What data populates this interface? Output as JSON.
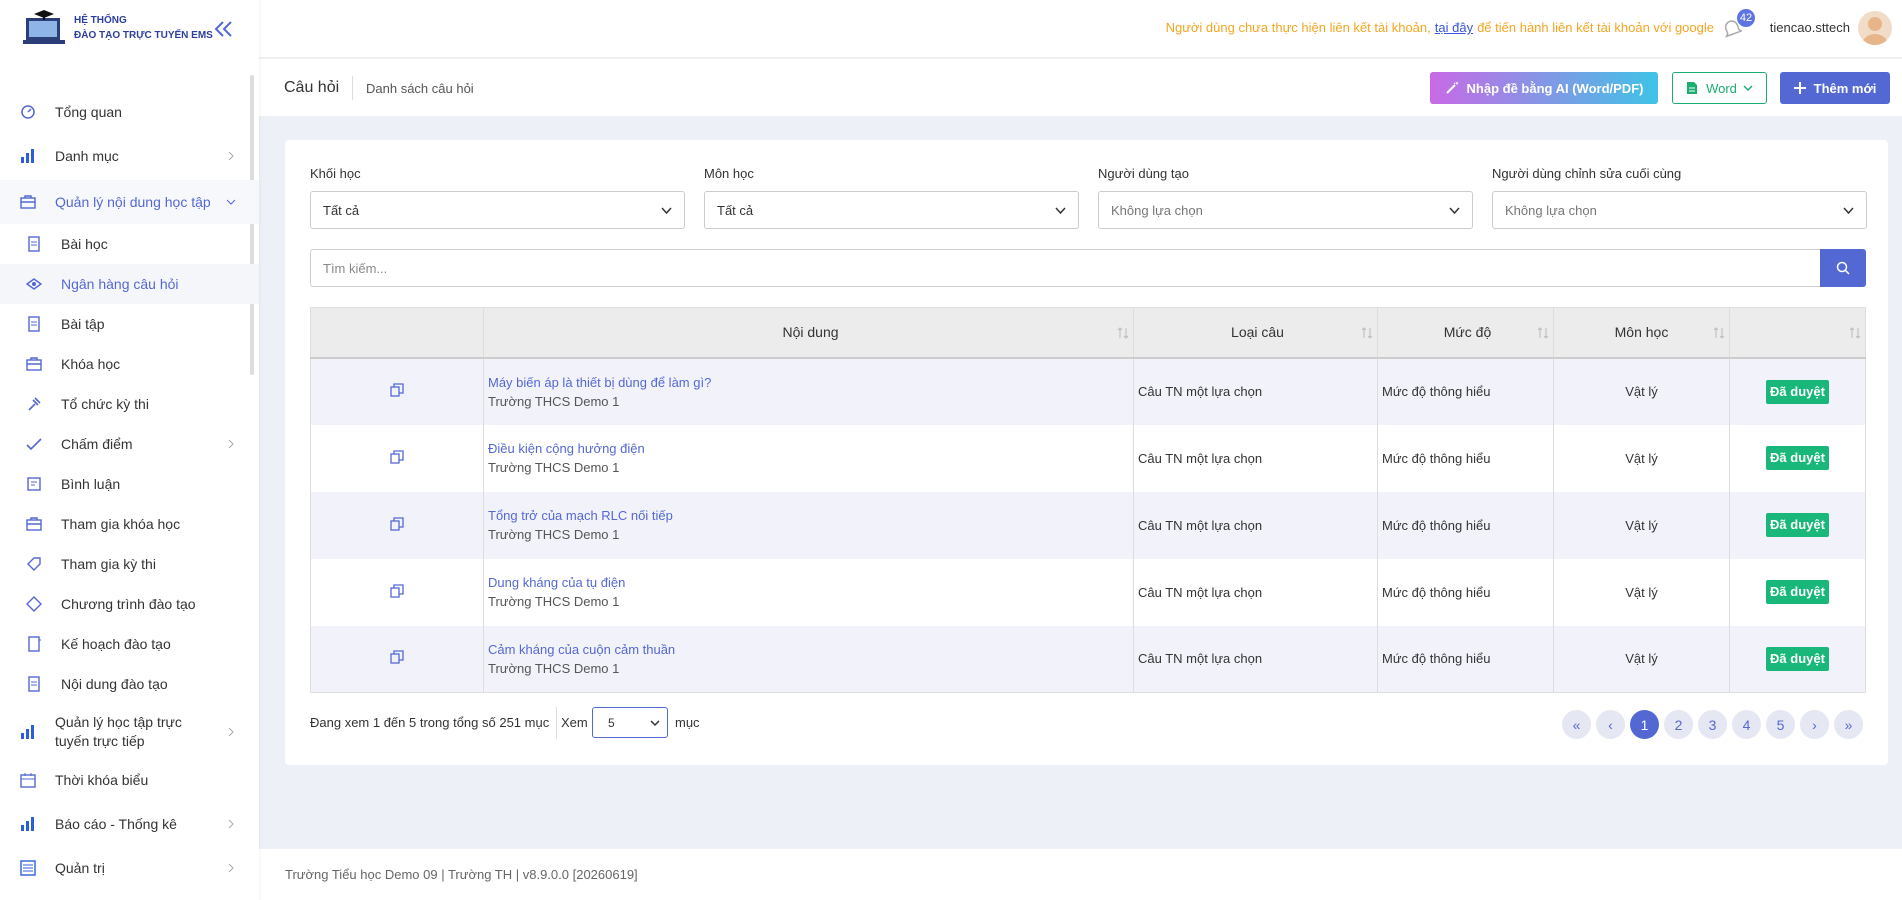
{
  "brand": {
    "line1": "HỆ THỐNG",
    "line2": "ĐÀO TẠO TRỰC TUYẾN EMS"
  },
  "menu": [
    {
      "label": "Tổng quan",
      "icon": "dashboard-icon"
    },
    {
      "label": "Danh mục",
      "icon": "bar-chart-icon"
    },
    {
      "label": "Quản lý nội dung học tập",
      "icon": "briefcase-icon"
    },
    {
      "label": "Bài học",
      "icon": "document-icon"
    },
    {
      "label": "Ngân hàng câu hỏi",
      "icon": "eye-icon"
    },
    {
      "label": "Bài tập",
      "icon": "document-icon"
    },
    {
      "label": "Khóa học",
      "icon": "briefcase-icon"
    },
    {
      "label": "Tổ chức kỳ thi",
      "icon": "gavel-icon"
    },
    {
      "label": "Chấm điểm",
      "icon": "check-icon"
    },
    {
      "label": "Bình luận",
      "icon": "comment-icon"
    },
    {
      "label": "Tham gia khóa học",
      "icon": "briefcase-icon"
    },
    {
      "label": "Tham gia kỳ thi",
      "icon": "tag-icon"
    },
    {
      "label": "Chương trình đào tạo",
      "icon": "diamond-icon"
    },
    {
      "label": "Kế hoạch đào tạo",
      "icon": "notebook-icon"
    },
    {
      "label": "Nội dung đào tạo",
      "icon": "document-icon"
    },
    {
      "label": "Quản lý học tập trực tuyến trực tiếp",
      "icon": "bar-chart-icon"
    },
    {
      "label": "Thời khóa biểu",
      "icon": "calendar-icon"
    },
    {
      "label": "Báo cáo - Thống kê",
      "icon": "bar-chart-icon"
    },
    {
      "label": "Quản trị",
      "icon": "settings-list-icon"
    }
  ],
  "header": {
    "notice_before": "Người dùng chưa thực hiện liên kết tài khoản,",
    "notice_link": "tại đây",
    "notice_after": "để tiến hành liên kết tài khoản với google",
    "notification_count": "42",
    "username": "tiencao.sttech"
  },
  "pagebar": {
    "crumb1": "Câu hỏi",
    "crumb2": "Danh sách câu hỏi",
    "ai_button": "Nhập đề bằng AI (Word/PDF)",
    "word_button": "Word",
    "add_button": "Thêm mới"
  },
  "filters": [
    {
      "label": "Khối học",
      "value": "Tất cả"
    },
    {
      "label": "Môn học",
      "value": "Tất cả"
    },
    {
      "label": "Người dùng tạo",
      "value": "Không lựa chọn"
    },
    {
      "label": "Người dùng chỉnh sửa cuối cùng",
      "value": "Không lựa chọn"
    }
  ],
  "search": {
    "placeholder": "Tìm kiếm..."
  },
  "table": {
    "headers": [
      "",
      "Nội dung",
      "Loại câu",
      "Mức độ",
      "Môn học",
      ""
    ],
    "rows": [
      {
        "title": "Máy biến áp là thiết bị dùng để làm gì?",
        "school": "Trường THCS Demo 1",
        "type": "Câu TN một lựa chọn",
        "level": "Mức độ thông hiểu",
        "subject": "Vật lý",
        "status": "Đã duyệt"
      },
      {
        "title": "Điều kiện cộng hưởng điện",
        "school": "Trường THCS Demo 1",
        "type": "Câu TN một lựa chọn",
        "level": "Mức độ thông hiểu",
        "subject": "Vật lý",
        "status": "Đã duyệt"
      },
      {
        "title": "Tổng trở của mạch RLC nối tiếp",
        "school": "Trường THCS Demo 1",
        "type": "Câu TN một lựa chọn",
        "level": "Mức độ thông hiểu",
        "subject": "Vật lý",
        "status": "Đã duyệt"
      },
      {
        "title": "Dung kháng của tụ điện",
        "school": "Trường THCS Demo 1",
        "type": "Câu TN một lựa chọn",
        "level": "Mức độ thông hiểu",
        "subject": "Vật lý",
        "status": "Đã duyệt"
      },
      {
        "title": "Cảm kháng của cuộn cảm thuần",
        "school": "Trường THCS Demo 1",
        "type": "Câu TN một lựa chọn",
        "level": "Mức độ thông hiểu",
        "subject": "Vật lý",
        "status": "Đã duyệt"
      }
    ]
  },
  "pagination": {
    "info": "Đang xem 1 đến 5 trong tổng số 251 mục",
    "show_label": "Xem",
    "page_size": "5",
    "unit": "mục",
    "first": "«",
    "prev": "‹",
    "pages": [
      "1",
      "2",
      "3",
      "4",
      "5"
    ],
    "next": "›",
    "last": "»"
  },
  "footer": {
    "text": "Trường Tiểu học Demo 09 | Trường TH | v8.9.0.0 [20260619]"
  },
  "colors": {
    "primary": "#5468d4",
    "success": "#19b779",
    "warning": "#f4a522",
    "word": "#1aaf6f"
  }
}
